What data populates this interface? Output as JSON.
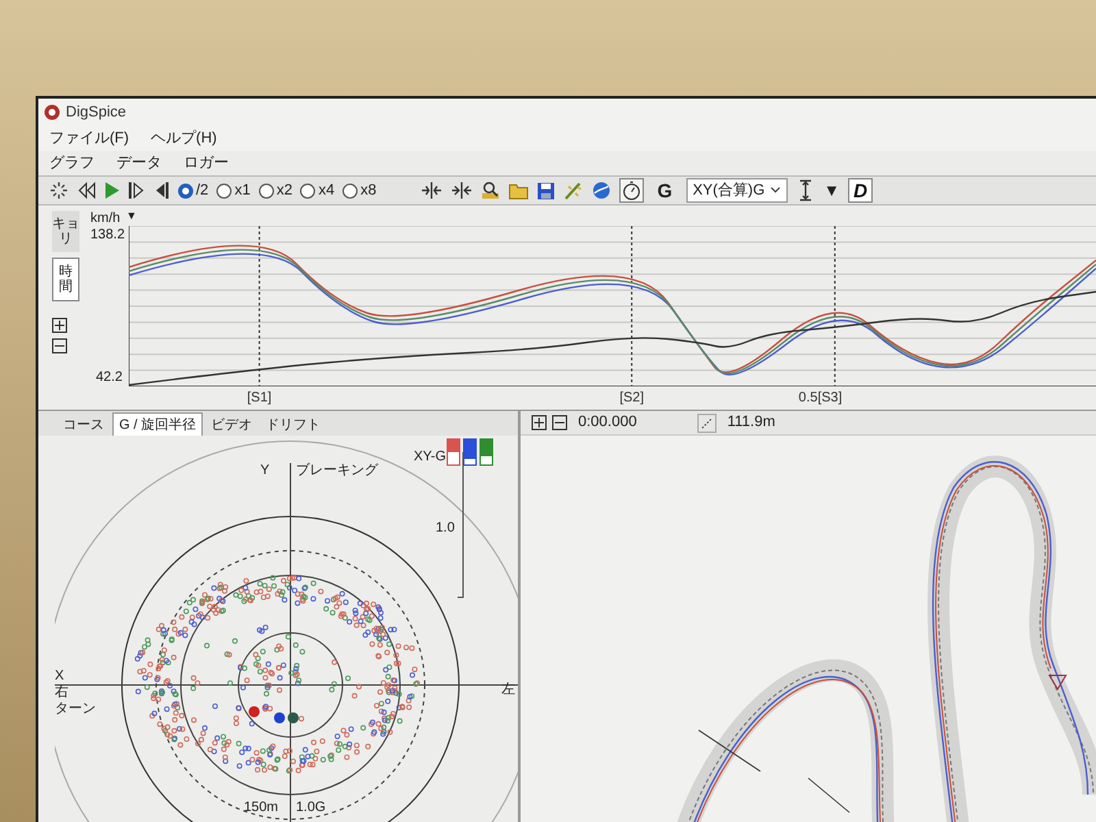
{
  "window": {
    "title": "DigSpice"
  },
  "menu": [
    {
      "label": "ファイル(F)"
    },
    {
      "label": "ヘルプ(H)"
    }
  ],
  "menu2": [
    {
      "label": "グラフ"
    },
    {
      "label": "データ"
    },
    {
      "label": "ロガー"
    }
  ],
  "toolbar": {
    "speeds": [
      {
        "label": "/2",
        "selected": true
      },
      {
        "label": "x1",
        "selected": false
      },
      {
        "label": "x2",
        "selected": false
      },
      {
        "label": "x4",
        "selected": false
      },
      {
        "label": "x8",
        "selected": false
      }
    ],
    "g_button": "G",
    "mode_select": "XY(合算)G",
    "marker_glyph": "▼",
    "d_button": "D"
  },
  "graph": {
    "side_tabs": [
      {
        "label": "キョリ",
        "selected": false
      },
      {
        "label": "時間",
        "selected": true
      }
    ],
    "unit": "km/h",
    "unit_marker": "▼",
    "y_max": "138.2",
    "y_min": "42.2",
    "series": [
      {
        "color": "#c8503c"
      },
      {
        "color": "#4a5ed0"
      },
      {
        "color": "#5a8a6a"
      },
      {
        "color": "#333333"
      }
    ],
    "x_labels": [
      {
        "label": "[S1]"
      },
      {
        "label": "[S2]"
      },
      {
        "label": "0.5[S3]"
      }
    ]
  },
  "panel_tabs": [
    {
      "label": "コース",
      "selected": false
    },
    {
      "label": "G / 旋回半径",
      "selected": true
    },
    {
      "label": "ビデオ",
      "selected": false
    },
    {
      "label": "ドリフト",
      "selected": false
    }
  ],
  "gg_plot": {
    "y_axis": "Y",
    "y_title": "ブレーキング",
    "x_axis": "X",
    "x_right_title": [
      "右",
      "ターン"
    ],
    "x_left_title": "左",
    "scale_label": "1.0",
    "legend_label": "XY-G",
    "legend": [
      {
        "color": "#d9534f",
        "level": 0.5
      },
      {
        "color": "#2a4fd8",
        "level": 0.8
      },
      {
        "color": "#2f8f2f",
        "level": 0.65
      }
    ],
    "radius_label": "150m",
    "g_label": "1.0G"
  },
  "map_toolbar": {
    "time": "0:00.000",
    "distance": "111.9m"
  }
}
